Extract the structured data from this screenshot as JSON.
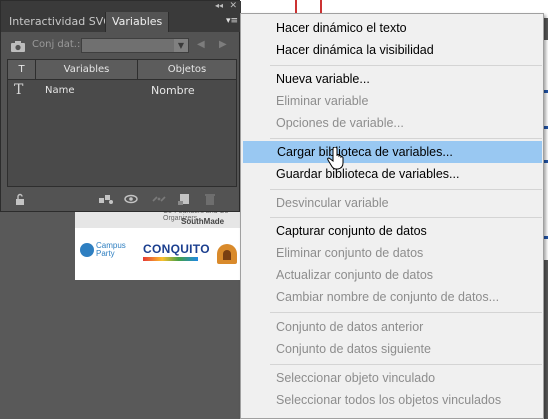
{
  "panel": {
    "tabs": [
      "Interactividad SVG",
      "Variables"
    ],
    "active_tab": "Variables",
    "dataset_label": "Conj dat.:",
    "dataset_value": "",
    "columns": [
      "T",
      "Variables",
      "Objetos"
    ],
    "rows": [
      {
        "type_icon": "T",
        "variable": "Name",
        "object": "Nombre"
      }
    ],
    "footer_icons": [
      "lock-icon",
      "make-object-dynamic-icon",
      "make-visibility-dynamic-icon",
      "unbind-icon",
      "new-variable-icon",
      "delete-icon"
    ]
  },
  "menu": {
    "items": [
      {
        "label": "Hacer dinámico el texto",
        "enabled": true
      },
      {
        "label": "Hacer dinámica la visibilidad",
        "enabled": true
      },
      {
        "label": "Nueva variable...",
        "enabled": true
      },
      {
        "label": "Eliminar variable",
        "enabled": false
      },
      {
        "label": "Opciones de variable...",
        "enabled": false
      },
      {
        "label": "Cargar biblioteca de variables...",
        "enabled": true,
        "highlighted": true
      },
      {
        "label": "Guardar biblioteca de variables...",
        "enabled": true
      },
      {
        "label": "Desvincular variable",
        "enabled": false
      },
      {
        "label": "Capturar conjunto de datos",
        "enabled": true
      },
      {
        "label": "Eliminar conjunto de datos",
        "enabled": false
      },
      {
        "label": "Actualizar conjunto de datos",
        "enabled": false
      },
      {
        "label": "Cambiar nombre de conjunto de datos...",
        "enabled": false
      },
      {
        "label": "Conjunto de datos anterior",
        "enabled": false
      },
      {
        "label": "Conjunto de datos siguiente",
        "enabled": false
      },
      {
        "label": "Seleccionar objeto vinculado",
        "enabled": false
      },
      {
        "label": "Seleccionar todos los objetos vinculados",
        "enabled": false
      }
    ]
  },
  "artboard": {
    "header_text": "SouthMade",
    "header_faint_text": "Co-Founders and Co-Organizers",
    "logos": [
      {
        "name": "Campus Party",
        "line1": "Campus",
        "line2": "Party"
      },
      {
        "name": "CONQUITO",
        "text": "CONQUITO"
      }
    ]
  },
  "colors": {
    "panel_bg": "#535353",
    "menu_bg": "#f0f0f0",
    "highlight": "#99c8f2",
    "disabled_text": "#8d8d8d"
  }
}
